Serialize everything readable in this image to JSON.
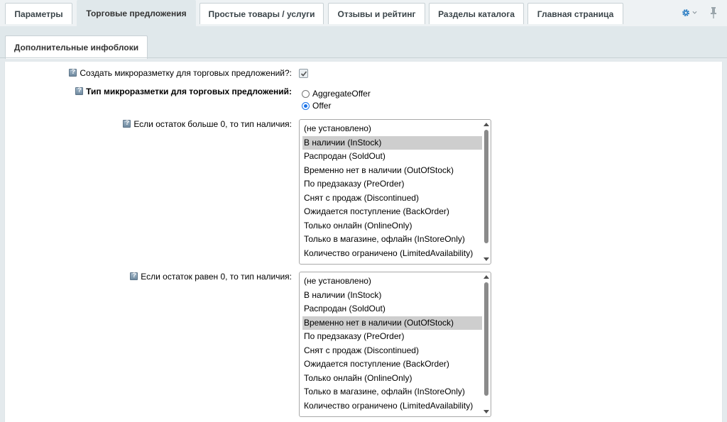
{
  "tabs": [
    {
      "label": "Параметры",
      "active": false
    },
    {
      "label": "Торговые предложения",
      "active": true
    },
    {
      "label": "Простые товары / услуги",
      "active": false
    },
    {
      "label": "Отзывы и рейтинг",
      "active": false
    },
    {
      "label": "Разделы каталога",
      "active": false
    },
    {
      "label": "Главная страница",
      "active": false
    }
  ],
  "subtabs": [
    {
      "label": "Дополнительные инфоблоки"
    }
  ],
  "form": {
    "create_markup": {
      "label": "Создать микроразметку для торговых предложений?:",
      "checked": true
    },
    "markup_type": {
      "label": "Тип микроразметки для торговых предложений:",
      "options": [
        "AggregateOffer",
        "Offer"
      ],
      "selected": "Offer"
    },
    "stock_positive": {
      "label": "Если остаток больше 0, то тип наличия:",
      "selected": "В наличии (InStock)"
    },
    "stock_zero": {
      "label": "Если остаток равен 0, то тип наличия:",
      "selected": "Временно нет в наличии (OutOfStock)"
    },
    "availability_options": [
      "(не установлено)",
      "В наличии (InStock)",
      "Распродан (SoldOut)",
      "Временно нет в наличии (OutOfStock)",
      "По предзаказу (PreOrder)",
      "Снят с продаж (Discontinued)",
      "Ожидается поступление (BackOrder)",
      "Только онлайн (OnlineOnly)",
      "Только в магазине, офлайн (InStoreOnly)",
      "Количество ограничено (LimitedAvailability)"
    ]
  },
  "colors": {
    "background": "#e4eaed",
    "active_tab": "#e0e8eb",
    "accent": "#2e7fc4",
    "selected_option": "#cecece"
  },
  "icons": [
    "gear-icon",
    "chevron-down-icon",
    "pin-icon",
    "help-icon",
    "checkmark-icon"
  ]
}
